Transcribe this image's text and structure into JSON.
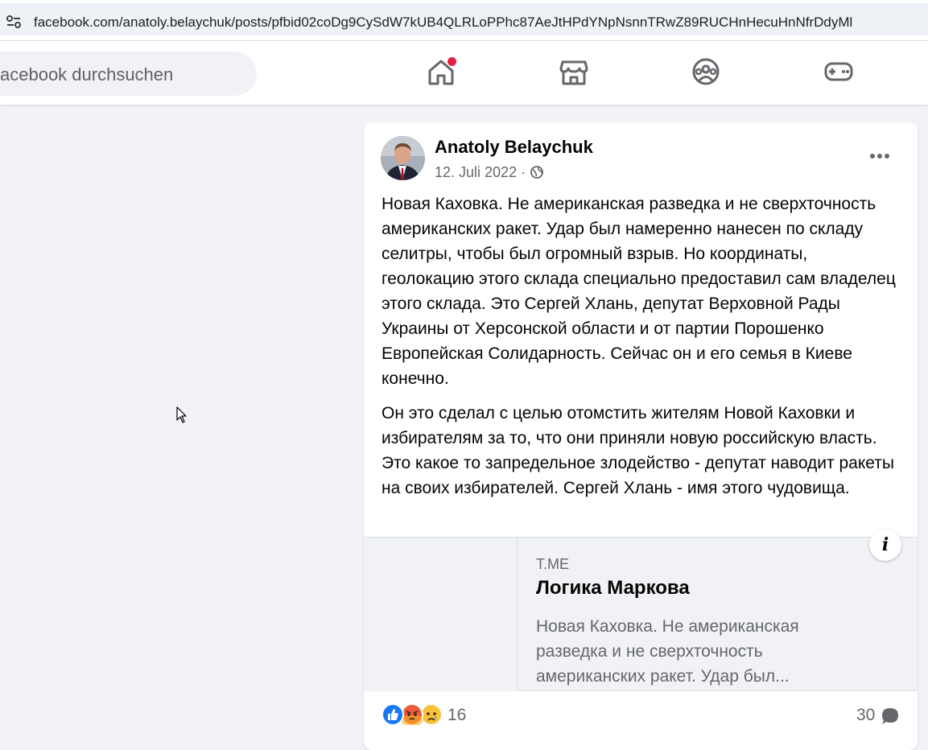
{
  "browser": {
    "url": "facebook.com/anatoly.belaychuk/posts/pfbid02coDg9CySdW7kUB4QLRLoPPhc87AeJtHPdYNpNsnnTRwZ89RUCHnHecuHnNfrDdyMl"
  },
  "nav": {
    "search_placeholder": "acebook durchsuchen",
    "icons": [
      "home-icon",
      "marketplace-icon",
      "groups-icon",
      "gaming-icon"
    ],
    "notification_color": "#e41e3f"
  },
  "post": {
    "author": "Anatoly Belaychuk",
    "date": "12. Juli 2022 ·",
    "privacy_icon": "globe-icon",
    "paragraphs": [
      "Новая Каховка. Не американская разведка и не сверхточность американских ракет. Удар был намеренно нанесен по складу селитры, чтобы был огромный взрыв. Но координаты, геолокацию  этого склада специально предоставил сам владелец этого склада. Это Сергей Хлань, депутат Верховной Рады Украины от Херсонской области и от партии Порошенко Европейская Солидарность. Сейчас он и его семья в Киеве конечно.",
      "Он это сделал с целью отомстить жителям Новой Каховки и избирателям за то, что они приняли новую российскую власть. Это какое то запредельное злодейство - депутат наводит ракеты на своих избирателей. Сергей Хлань - имя этого чудовища."
    ],
    "link_preview": {
      "domain": "T.ME",
      "title": "Логика Маркова",
      "description": "Новая Каховка. Не американская разведка и не сверхточность американских ракет. Удар был..."
    },
    "reactions": {
      "types": [
        "like",
        "angry",
        "sad"
      ],
      "count": "16"
    },
    "comments_count": "30"
  },
  "colors": {
    "accent": "#1877f2",
    "page_bg": "#f0f2f5",
    "secondary_text": "#65676b"
  }
}
